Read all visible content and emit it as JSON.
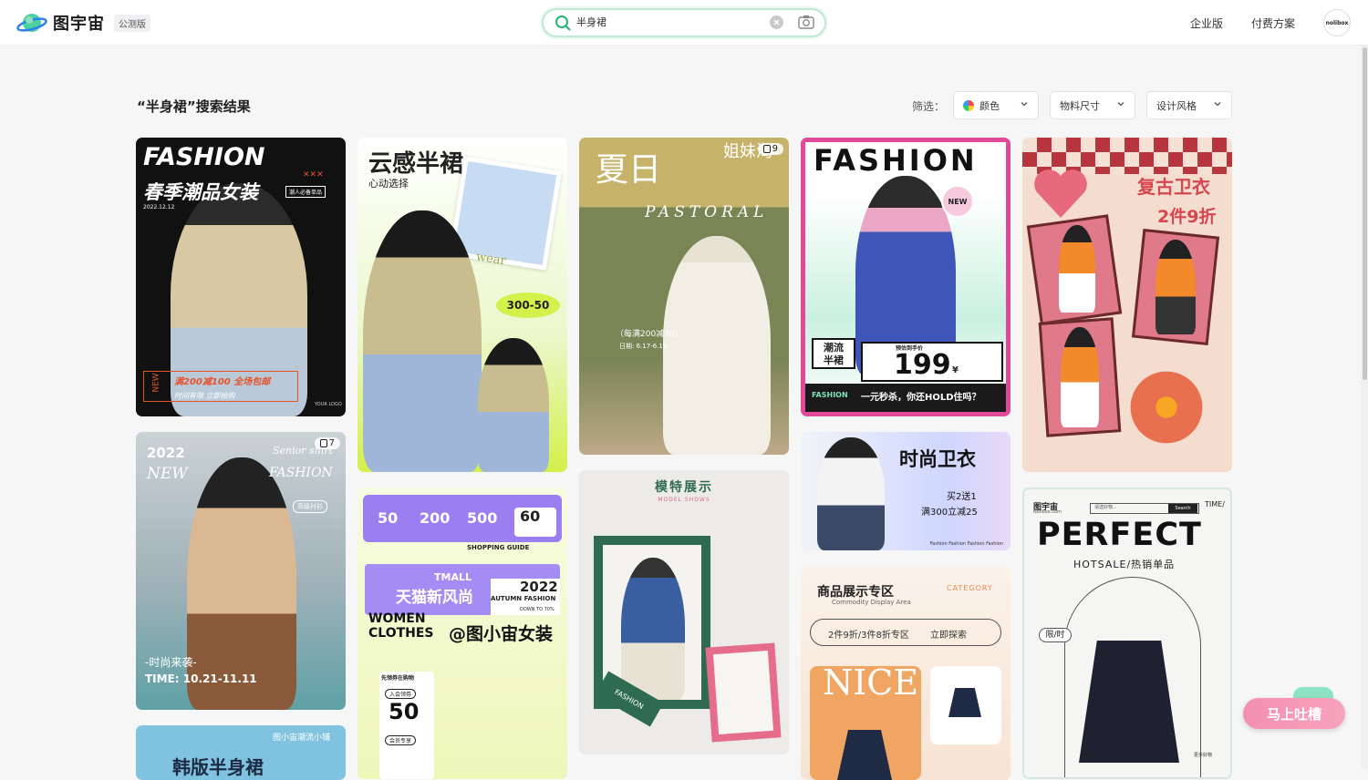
{
  "header": {
    "logo_text": "图宇宙",
    "beta_label": "公测版",
    "search_value": "半身裙",
    "nav_enterprise": "企业版",
    "nav_pricing": "付费方案",
    "avatar_text": "nolibox"
  },
  "results": {
    "title": "“半身裙”搜索结果",
    "filter_label": "筛选：",
    "filters": [
      {
        "label": "颜色"
      },
      {
        "label": "物料尺寸"
      },
      {
        "label": "设计风格"
      }
    ]
  },
  "cards": {
    "c1": {
      "title": "FASHION",
      "subtitle": "春季潮品女装",
      "date": "2022.12.12",
      "tag": "潮人必备单品",
      "side": "NEW",
      "promo1": "满200减100 全场包邮",
      "promo2": "时间有限 立即抢购",
      "logo": "YOUR LOGO"
    },
    "c2": {
      "year": "2022",
      "count": "7",
      "new": "NEW",
      "right1": "Senior shirt",
      "right2": "FASHION",
      "tag": "高级衬衫",
      "bottom1": "-时尚来袭-",
      "bottom2": "TIME: 10.21-11.11"
    },
    "c3": {
      "shop": "图小宙潮流小铺",
      "title": "韩版半身裙"
    },
    "c4": {
      "title": "云感半裙",
      "subtitle": "心动选择",
      "wear": "wear",
      "price": "300-50"
    },
    "c5": {
      "n1": "50",
      "n2": "200",
      "n3": "500",
      "n4": "60",
      "guide": "SHOPPING GUIDE",
      "tmall": "TMALL",
      "title": "天猫新风尚",
      "year": "2022",
      "season": "AUTUMN FASHION",
      "discount": "DOWN TO 70%",
      "women": "WOMEN",
      "clothes": "CLOTHES",
      "brand": "@图小宙女装",
      "coupon_title": "先领券在购物",
      "coupon_enter": "入会领券",
      "coupon_value": "50",
      "member": "会员专享"
    },
    "c6": {
      "title1": "夏日",
      "title2": "姐妹淘",
      "count": "9",
      "script": "PASTORAL",
      "promo": "（每满200减30）",
      "date": "日期: 6.17-6.19"
    },
    "c7": {
      "title": "模特展示",
      "subtitle": "MODEL SHOWS",
      "tape": "FASHION"
    },
    "c8": {
      "title": "FASHION",
      "new": "NEW",
      "tag1": "潮流",
      "tag2": "半裙",
      "price_label": "预估到手价",
      "price": "199",
      "unit": "¥",
      "brand": "FASHION",
      "slogan": "一元秒杀，你还HOLD住吗？"
    },
    "c9": {
      "title": "时尚卫衣",
      "promo1": "买2送1",
      "promo2": "满300立减25",
      "footer": "Fashion  Fashion  Fashion  Fashion"
    },
    "c10": {
      "title": "商品展示专区",
      "subtitle": "Commodity Display Area",
      "category": "CATEGORY",
      "cta": "2件9折/3件8折专区",
      "cta2": "立即探索",
      "nice": "NICE"
    },
    "c11": {
      "title": "复古卫衣",
      "subtitle": "2件9折"
    },
    "c12": {
      "brand": "图宇宙",
      "brand_en": "Nolibox.com",
      "search_hint": "请选好物...",
      "search_btn": "Search",
      "time": "TIME/",
      "title": "PERFECT",
      "subtitle": "HOTSALE/热销单品",
      "badge": "限/时",
      "more": "更多好物"
    }
  },
  "feedback": {
    "label": "马上吐槽"
  },
  "colors": {
    "accent": "#22b573",
    "search_border": "#bfe9d2",
    "feedback": "#f48fb1"
  }
}
